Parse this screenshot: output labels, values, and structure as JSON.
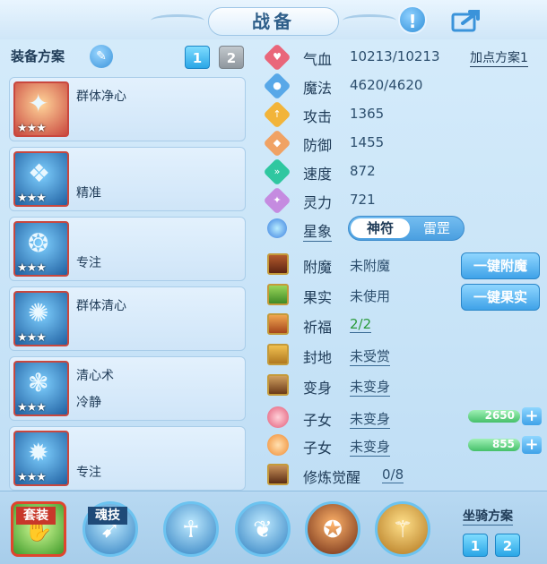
{
  "title": "战备",
  "header_icons": {
    "info": "!",
    "share": "share-icon"
  },
  "left": {
    "header": "装备方案",
    "tabs": [
      "1",
      "2"
    ],
    "cards": [
      {
        "line1": "群体净心",
        "line2": "",
        "stars": "★★★"
      },
      {
        "line1": "",
        "line2": "精准",
        "stars": "★★★"
      },
      {
        "line1": "",
        "line2": "专注",
        "stars": "★★★"
      },
      {
        "line1": "群体清心",
        "line2": "",
        "stars": "★★★"
      },
      {
        "line1": "清心术",
        "line2": "冷静",
        "stars": "★★★"
      },
      {
        "line1": "",
        "line2": "专注",
        "stars": "★★★"
      }
    ]
  },
  "stats": {
    "plan_link": "加点方案1",
    "rows": [
      {
        "name": "气血",
        "value": "10213/10213",
        "icon": "heart-icon",
        "color": "#e9667a"
      },
      {
        "name": "魔法",
        "value": "4620/4620",
        "icon": "mana-icon",
        "color": "#58a8e8"
      },
      {
        "name": "攻击",
        "value": "1365",
        "icon": "attack-icon",
        "color": "#f2b43a"
      },
      {
        "name": "防御",
        "value": "1455",
        "icon": "defense-icon",
        "color": "#f0a264"
      },
      {
        "name": "速度",
        "value": "872",
        "icon": "speed-icon",
        "color": "#2fc7a0"
      },
      {
        "name": "灵力",
        "value": "721",
        "icon": "spirit-icon",
        "color": "#c58be0"
      }
    ]
  },
  "astro": {
    "label": "星象",
    "options": [
      "神符",
      "雷罡"
    ]
  },
  "extras": [
    {
      "name": "附魔",
      "value": "未附魔"
    },
    {
      "name": "果实",
      "value": "未使用"
    },
    {
      "name": "祈福",
      "value": "2/2"
    },
    {
      "name": "封地",
      "value": "未受赏"
    },
    {
      "name": "变身",
      "value": "未变身"
    },
    {
      "name": "子女",
      "value": "未变身"
    },
    {
      "name": "子女",
      "value": "未变身"
    },
    {
      "name": "修炼觉醒",
      "value": "0/8"
    }
  ],
  "buttons": {
    "enchant": "一键附魔",
    "fruit": "一键果实"
  },
  "bars": [
    {
      "value": "2650"
    },
    {
      "value": "855"
    }
  ],
  "bottom": {
    "outfit": "套装",
    "soul": "魂技",
    "mount": "坐骑方案",
    "mount_tabs": [
      "1",
      "2"
    ]
  }
}
